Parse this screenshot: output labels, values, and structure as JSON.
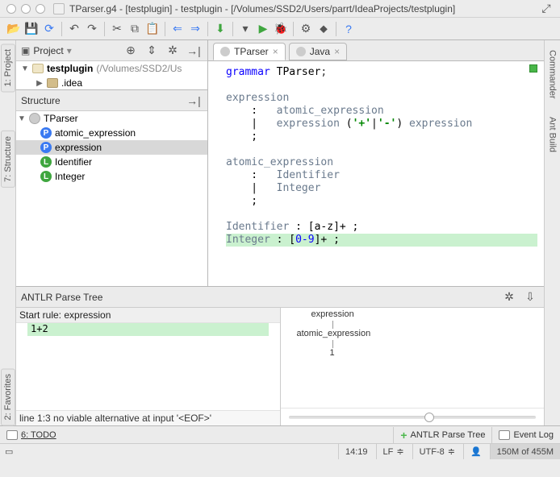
{
  "window": {
    "title": "TParser.g4 - [testplugin] - testplugin - [/Volumes/SSD2/Users/parrt/IdeaProjects/testplugin]"
  },
  "project_tool": {
    "title": "Project",
    "module": "testplugin",
    "module_path": "(/Volumes/SSD2/Us",
    "child": ".idea"
  },
  "structure_tool": {
    "title": "Structure",
    "root": "TParser",
    "items": [
      {
        "kind": "rule",
        "label": "atomic_expression"
      },
      {
        "kind": "rule",
        "label": "expression",
        "selected": true
      },
      {
        "kind": "tok",
        "label": "Identifier"
      },
      {
        "kind": "tok",
        "label": "Integer"
      }
    ]
  },
  "left_tabs": {
    "project": "1: Project",
    "structure": "7: Structure",
    "favorites": "2: Favorites"
  },
  "right_tabs": {
    "commander": "Commander",
    "ant": "Ant Build"
  },
  "editor_tabs": [
    {
      "label": "TParser",
      "active": true
    },
    {
      "label": "Java",
      "active": false
    }
  ],
  "code": {
    "l1a": "grammar",
    "l1b": " TParser",
    "l1c": ";",
    "l3": "expression",
    "l4a": "    :   ",
    "l4b": "atomic_expression",
    "l5a": "    |   ",
    "l5b": "expression",
    "l5c": " (",
    "l5d": "'+'",
    "l5e": "|",
    "l5f": "'-'",
    "l5g": ") ",
    "l5h": "expression",
    "l6": "    ;",
    "l8": "atomic_expression",
    "l9a": "    :   ",
    "l9b": "Identifier",
    "l10a": "    |   ",
    "l10b": "Integer",
    "l11": "    ;",
    "l13a": "Identifier",
    "l13b": " : [a-z]+ ;",
    "l14a": "Integer",
    "l14b": " : [",
    "l14c": "0-9",
    "l14d": "]+ ;"
  },
  "parse_panel": {
    "title": "ANTLR Parse Tree",
    "start_rule_label": "Start rule: expression",
    "input": "1+2",
    "tree": {
      "n0": "expression",
      "n1": "atomic_expression",
      "n2": "1"
    },
    "error": "line 1:3 no viable alternative at input '<EOF>'"
  },
  "bottom_buttons": {
    "todo": "6: TODO",
    "parse": "ANTLR Parse Tree",
    "eventlog": "Event Log"
  },
  "status": {
    "pos": "14:19",
    "eol": "LF",
    "enc": "UTF-8",
    "mem": "150M of 455M"
  }
}
